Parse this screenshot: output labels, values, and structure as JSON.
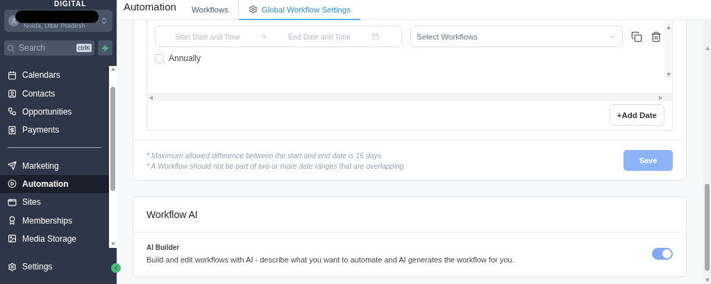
{
  "sidebar": {
    "logo": "DIGITAL",
    "location": {
      "subtitle": "Noida, Uttar Pradesh"
    },
    "search": {
      "placeholder": "Search",
      "shortcut": "ctrlK"
    },
    "items": [
      {
        "kind": "item",
        "label": "Calendars",
        "selected": false
      },
      {
        "kind": "item",
        "label": "Contacts",
        "selected": false
      },
      {
        "kind": "item",
        "label": "Opportunities",
        "selected": false
      },
      {
        "kind": "item",
        "label": "Payments",
        "selected": false
      },
      {
        "kind": "divider"
      },
      {
        "kind": "item",
        "label": "Marketing",
        "selected": false
      },
      {
        "kind": "item",
        "label": "Automation",
        "selected": true
      },
      {
        "kind": "item",
        "label": "Sites",
        "selected": false
      },
      {
        "kind": "item",
        "label": "Memberships",
        "selected": false
      },
      {
        "kind": "item",
        "label": "Media Storage",
        "selected": false
      }
    ],
    "settings": "Settings"
  },
  "header": {
    "title": "Automation",
    "tabs": [
      {
        "label": "Workflows",
        "selected": false
      },
      {
        "label": "Global Workflow Settings",
        "selected": true
      }
    ]
  },
  "date_range": {
    "start_placeholder": "Start Date and Time",
    "end_placeholder": "End Date and Time",
    "workflow_placeholder": "Select Workflows",
    "annually": {
      "label": "Annually",
      "checked": false
    },
    "add_button": "+Add Date"
  },
  "notes": [
    "* Maximum allowed difference between the start and end date is 15 days.",
    "* A Workflow should not be part of two or more date ranges that are overlapping."
  ],
  "save_button": {
    "label": "Save",
    "disabled": true
  },
  "workflow_ai": {
    "title": "Workflow AI",
    "setting": {
      "label": "AI Builder",
      "description": "Build and edit workflows with AI - describe what you want to automate and AI generates the workflow for you.",
      "on": true
    }
  }
}
